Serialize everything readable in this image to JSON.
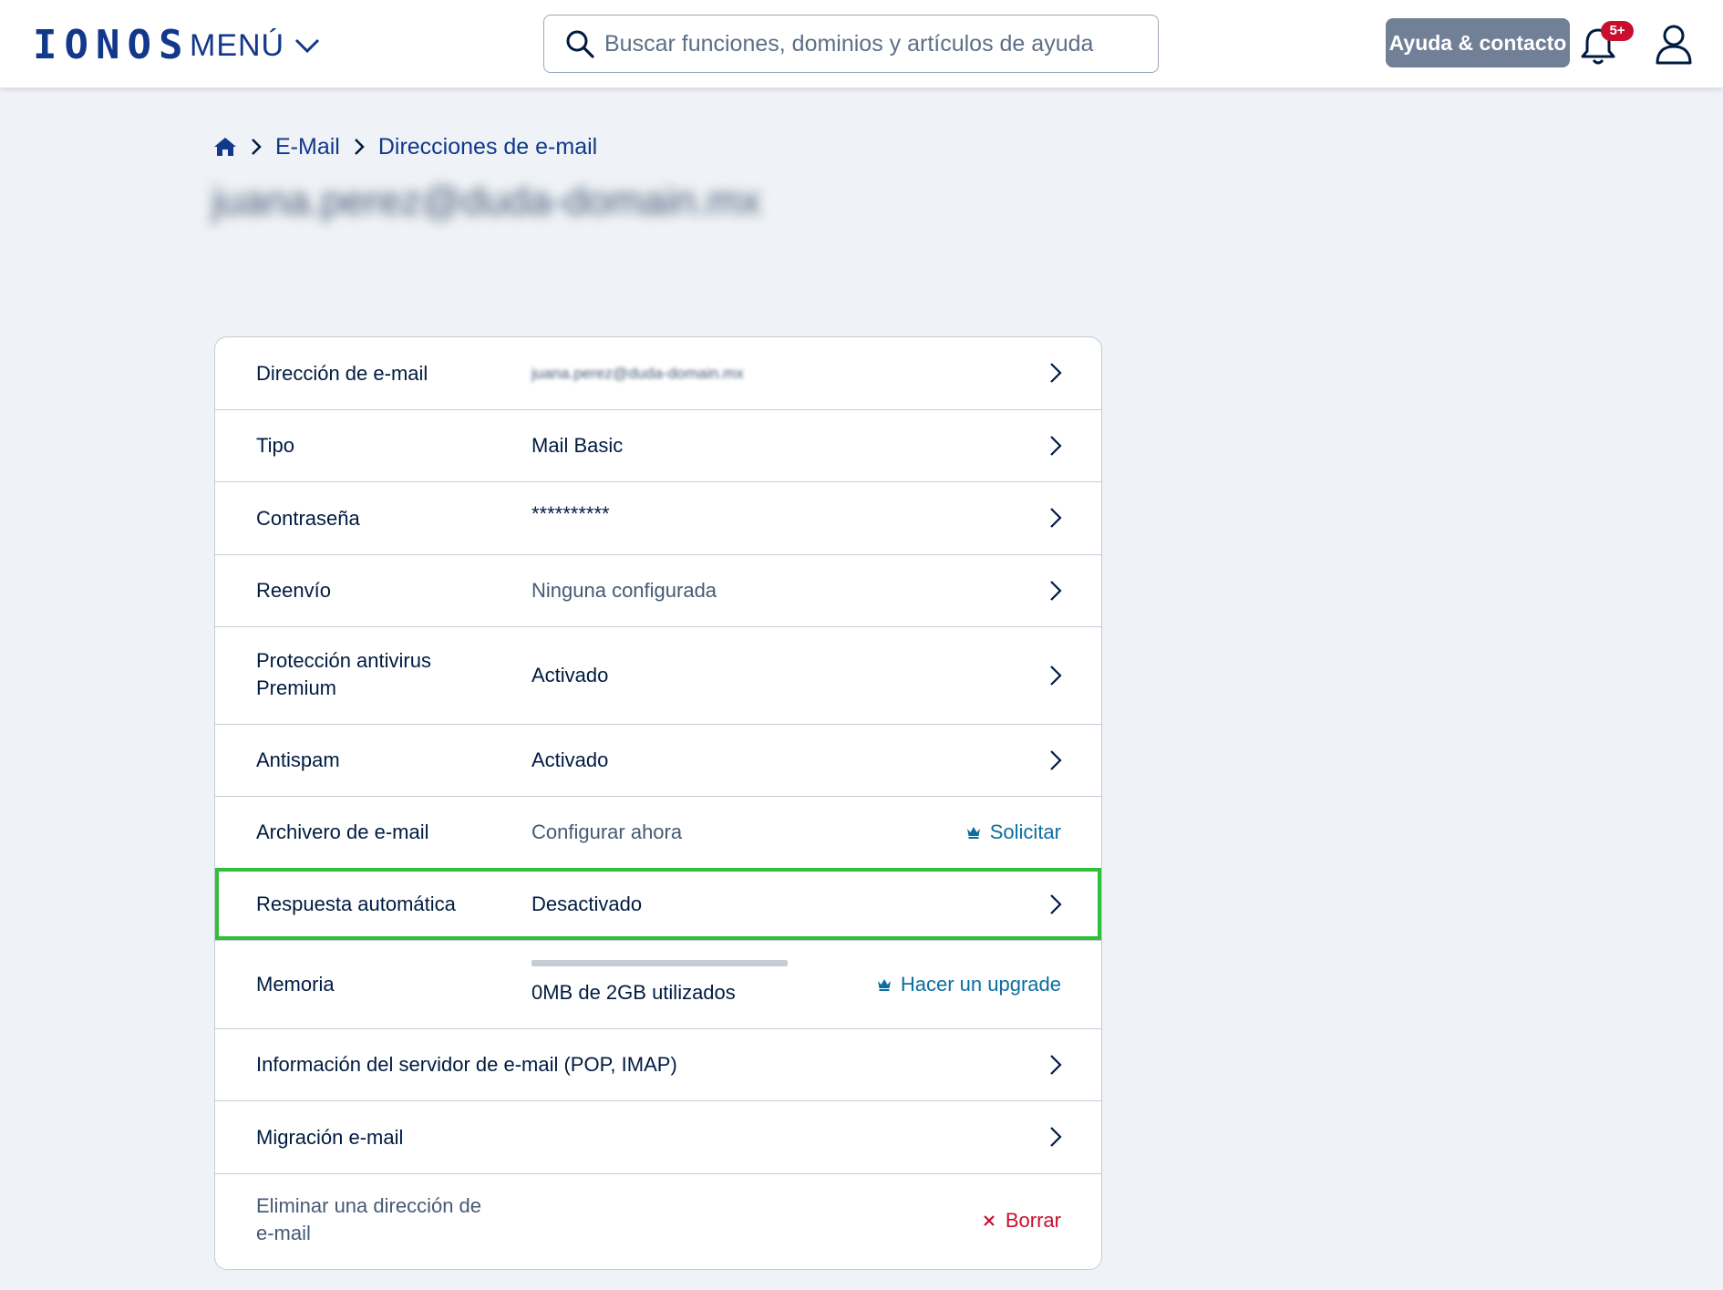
{
  "header": {
    "logo": "IONOS",
    "menu_label": "MENÚ",
    "search_placeholder": "Buscar funciones, dominios y artículos de ayuda",
    "help_label": "Ayuda & contacto",
    "notifications_badge": "5+"
  },
  "breadcrumb": {
    "items": [
      "E-Mail",
      "Direcciones de e-mail"
    ]
  },
  "page": {
    "title": "juana.perez@duda-domain.mx"
  },
  "rows": [
    {
      "label": "Dirección de e-mail",
      "value": "juana.perez@duda-domain.mx"
    },
    {
      "label": "Tipo",
      "value": "Mail Basic"
    },
    {
      "label": "Contraseña",
      "value": "**********"
    },
    {
      "label": "Reenvío",
      "value": "Ninguna configurada"
    },
    {
      "label": "Protección antivirus Premium",
      "value": "Activado"
    },
    {
      "label": "Antispam",
      "value": "Activado"
    },
    {
      "label": "Archivero de e-mail",
      "value": "Configurar ahora",
      "action": "Solicitar"
    },
    {
      "label": "Respuesta automática",
      "value": "Desactivado"
    },
    {
      "label": "Memoria",
      "value": "0MB de 2GB utilizados",
      "action": "Hacer un upgrade",
      "usage_fraction": 0.0
    },
    {
      "label": "Información del servidor de e-mail (POP, IMAP)"
    },
    {
      "label": "Migración e-mail"
    },
    {
      "label": "Eliminar una dirección de e-mail",
      "action": "Borrar"
    }
  ],
  "colors": {
    "brand": "#11388a",
    "link": "#0b6e9f",
    "danger": "#c8102e",
    "highlight": "#2fbf3a",
    "background": "#eff2f6"
  },
  "icons": [
    "chevron-down-icon",
    "search-icon",
    "bell-icon",
    "user-icon",
    "home-icon",
    "chevron-right-icon",
    "crown-icon",
    "close-icon"
  ]
}
